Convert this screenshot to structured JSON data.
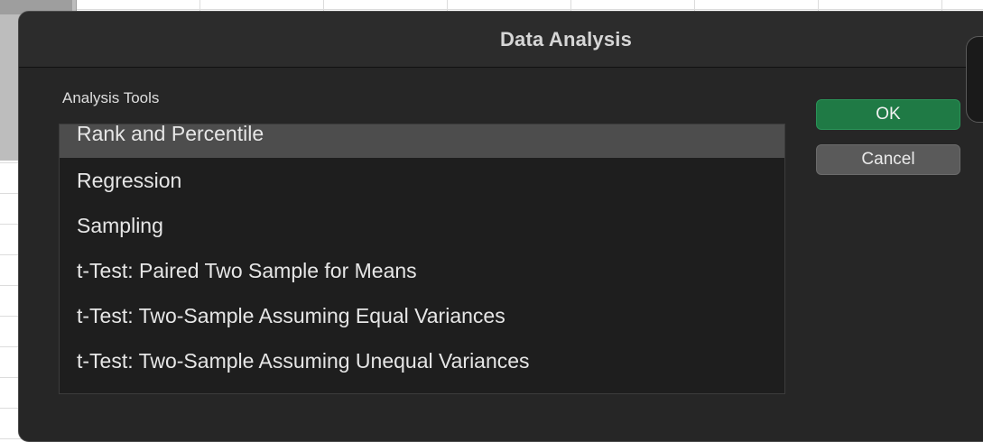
{
  "dialog": {
    "title": "Data Analysis",
    "section_label": "Analysis Tools",
    "tools": [
      {
        "label": "Rank and Percentile",
        "selected": true
      },
      {
        "label": "Regression",
        "selected": false
      },
      {
        "label": "Sampling",
        "selected": false
      },
      {
        "label": "t-Test: Paired Two Sample for Means",
        "selected": false
      },
      {
        "label": "t-Test: Two-Sample Assuming Equal Variances",
        "selected": false
      },
      {
        "label": "t-Test: Two-Sample Assuming Unequal Variances",
        "selected": false
      }
    ],
    "ok_label": "OK",
    "cancel_label": "Cancel"
  },
  "colors": {
    "dialog_background": "#262626",
    "selection": "#4d4d4d",
    "ok_button": "#1f7a45",
    "cancel_button": "#5a5a5a"
  }
}
